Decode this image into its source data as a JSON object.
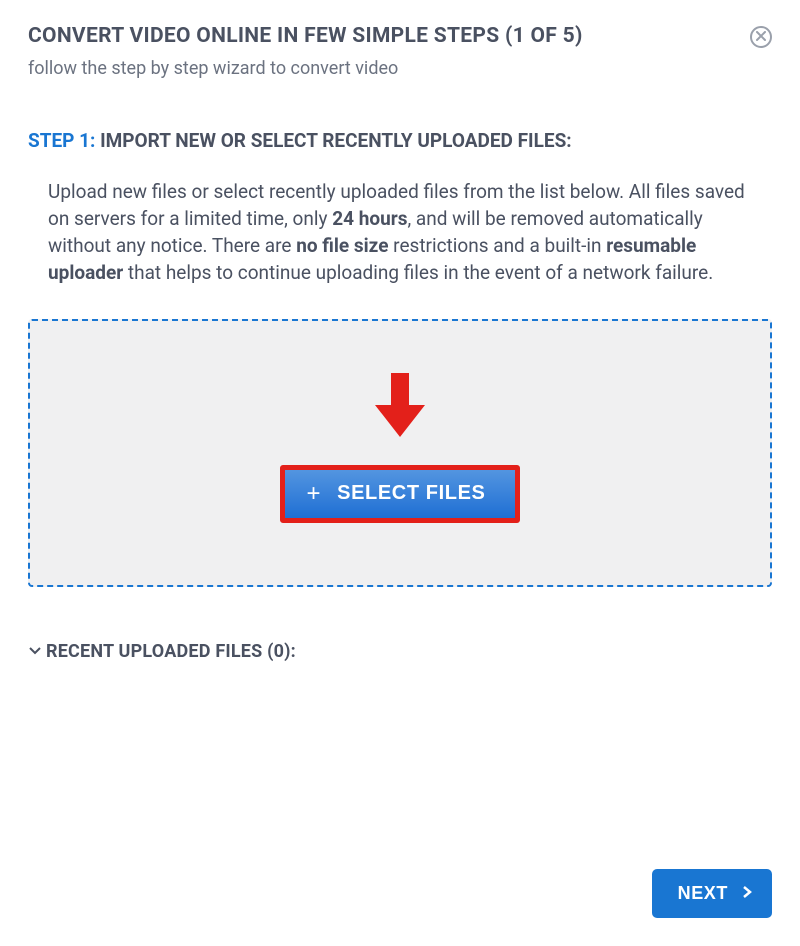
{
  "header": {
    "title": "CONVERT VIDEO ONLINE IN FEW SIMPLE STEPS (1 OF 5)",
    "subtitle": "follow the step by step wizard to convert video"
  },
  "step": {
    "label": "STEP 1:",
    "heading": " IMPORT NEW OR SELECT RECENTLY UPLOADED FILES:"
  },
  "description": {
    "part1": "Upload new files or select recently uploaded files from the list below. All files saved on servers for a limited time, only ",
    "bold1": "24 hours",
    "part2": ", and will be removed automatically without any notice. There are ",
    "bold2": "no file size",
    "part3": " restrictions and a built-in ",
    "bold3": "resumable uploader",
    "part4": " that helps to continue uploading files in the event of a network failure."
  },
  "buttons": {
    "select_files": "SELECT FILES",
    "next": "NEXT"
  },
  "recent": {
    "label": "RECENT UPLOADED FILES (0):"
  },
  "colors": {
    "primary_blue": "#1976d2",
    "highlight_red": "#e3201a",
    "text_gray": "#4a5161"
  }
}
